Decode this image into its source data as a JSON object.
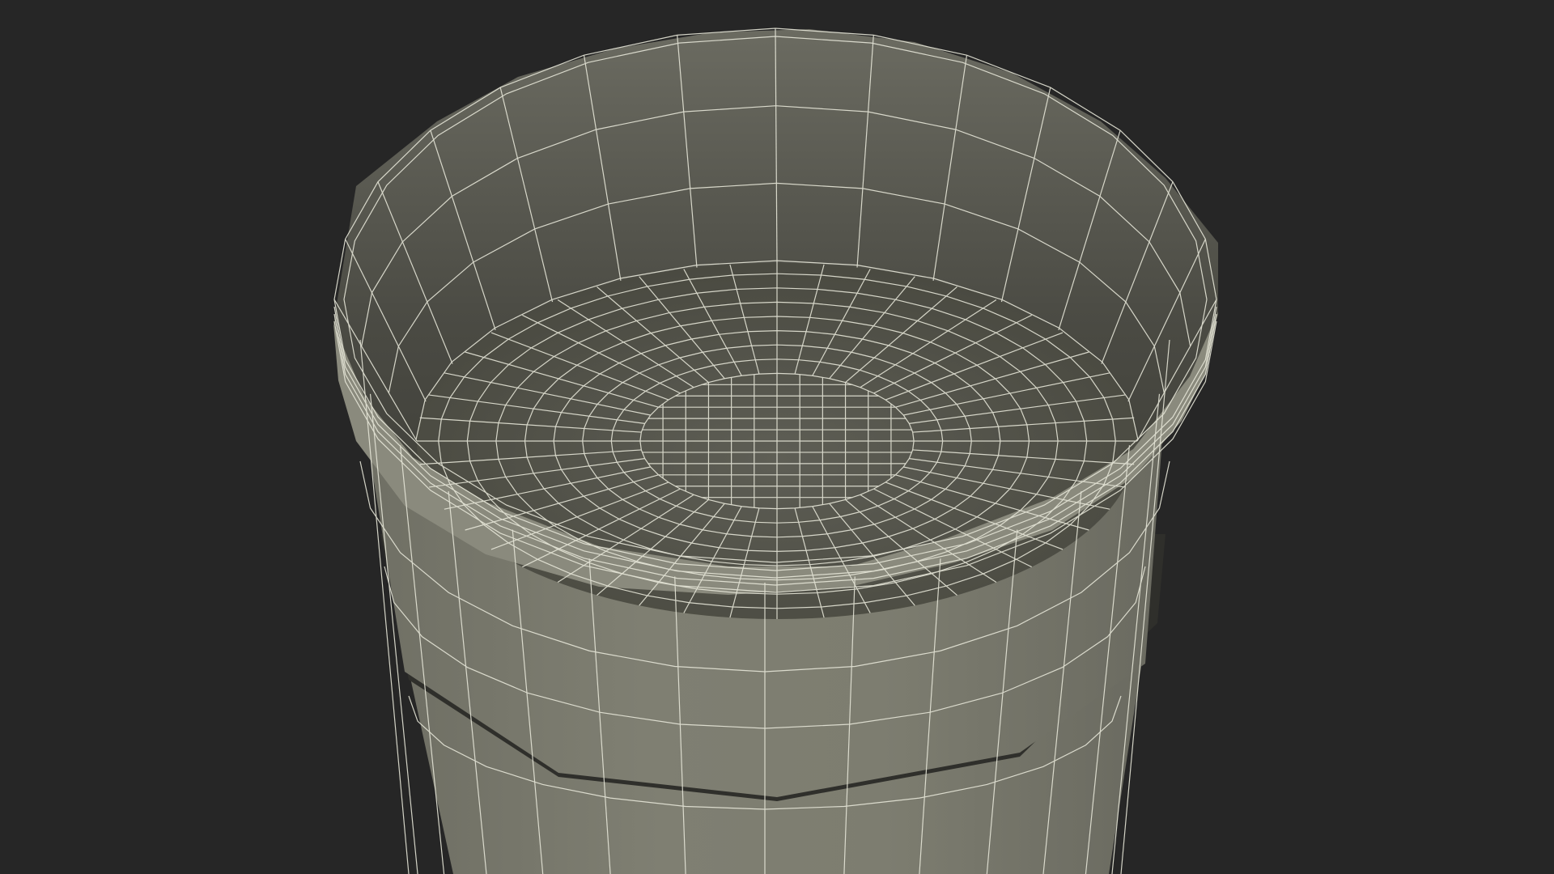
{
  "scene": {
    "object": "cup-wireframe-render",
    "colors": {
      "background": "#262626",
      "surface_outer": "#7b7b6f",
      "surface_inner_top": "#6a6a60",
      "surface_inner_bottom": "#3e3e38",
      "bottom_fill": "#55554d",
      "wire": "#e8e8da",
      "band_shadow": "#2e2e2a"
    }
  }
}
